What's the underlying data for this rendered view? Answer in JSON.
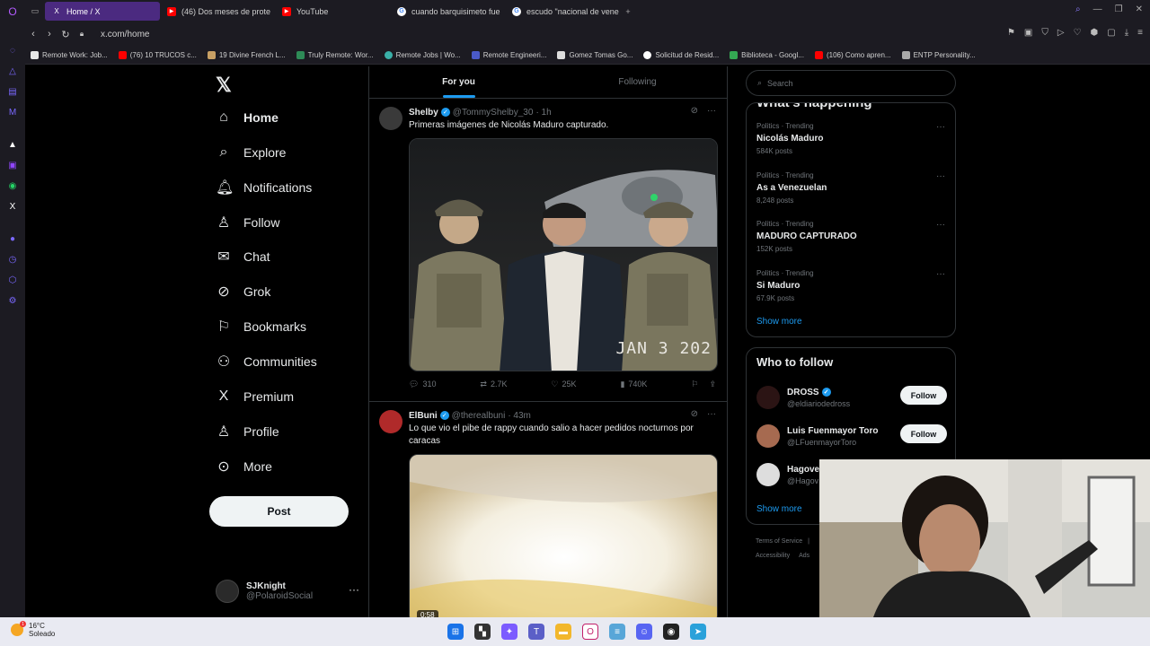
{
  "browser": {
    "tabs": [
      {
        "title": "Home / X",
        "icon": "x-logo-icon",
        "active": true
      },
      {
        "title": "(46) Dos meses de prote",
        "icon": "youtube-icon"
      },
      {
        "title": "YouTube",
        "icon": "youtube-icon"
      },
      {
        "title": "cuando barquisimeto fue",
        "icon": "google-icon"
      },
      {
        "title": "escudo \"nacional de vene",
        "icon": "google-icon"
      }
    ],
    "url": "x.com/home",
    "bookmarks": [
      {
        "label": "Remote Work: Job...",
        "color": "#e7e7e7"
      },
      {
        "label": "(76) 10 TRUCOS c...",
        "color": "#ff0000"
      },
      {
        "label": "19 Divine French L...",
        "color": "#c8a064"
      },
      {
        "label": "Truly Remote: Wor...",
        "color": "#2e8b57"
      },
      {
        "label": "Remote Jobs | Wo...",
        "color": "#3ab0a8"
      },
      {
        "label": "Remote Engineeri...",
        "color": "#4a5ac8"
      },
      {
        "label": "Gomez Tomas Go...",
        "color": "#dddddd"
      },
      {
        "label": "Solicitud de Resid...",
        "color": "#ffffff"
      },
      {
        "label": "Biblioteca - Googl...",
        "color": "#34a853"
      },
      {
        "label": "(106) Como apren...",
        "color": "#ff0000"
      },
      {
        "label": "ENTP Personality...",
        "color": "#aaaaaa"
      }
    ]
  },
  "nav": {
    "items": [
      {
        "label": "Home",
        "icon": "home-icon",
        "glyph": "⌂",
        "active": true
      },
      {
        "label": "Explore",
        "icon": "search-icon",
        "glyph": "⌕"
      },
      {
        "label": "Notifications",
        "icon": "bell-icon",
        "glyph": "♫"
      },
      {
        "label": "Follow",
        "icon": "person-plus-icon",
        "glyph": "⚇"
      },
      {
        "label": "Chat",
        "icon": "mail-icon",
        "glyph": "✉"
      },
      {
        "label": "Grok",
        "icon": "grok-icon",
        "glyph": "⊘"
      },
      {
        "label": "Bookmarks",
        "icon": "bookmark-icon",
        "glyph": "⚐"
      },
      {
        "label": "Communities",
        "icon": "people-icon",
        "glyph": "⚉"
      },
      {
        "label": "Premium",
        "icon": "x-logo-icon",
        "glyph": "X"
      },
      {
        "label": "Profile",
        "icon": "person-icon",
        "glyph": "♙"
      },
      {
        "label": "More",
        "icon": "more-circle-icon",
        "glyph": "⊙"
      }
    ],
    "post_label": "Post",
    "account": {
      "name": "SJKnight",
      "handle": "@PolaroidSocial"
    }
  },
  "feed": {
    "tabs": [
      "For you",
      "Following"
    ],
    "tweets": [
      {
        "name": "Shelby",
        "handle": "@TommyShelby_30",
        "time": "· 1h",
        "text": "Primeras imágenes de Nicolás Maduro capturado.",
        "media_caption": "JAN 3 202",
        "replies": "310",
        "retweets": "2.7K",
        "likes": "25K",
        "views": "740K"
      },
      {
        "name": "ElBuni",
        "handle": "@therealbuni",
        "time": "· 43m",
        "text": "Lo que vio el pibe de rappy cuando salio a hacer pedidos nocturnos por caracas",
        "video_duration": "0:58"
      }
    ]
  },
  "right": {
    "search_placeholder": "Search",
    "happening_title": "What's happening",
    "trends": [
      {
        "category": "Politics · Trending",
        "name": "Nicolás Maduro",
        "count": "584K posts"
      },
      {
        "category": "Politics · Trending",
        "name": "As a Venezuelan",
        "count": "8,248 posts"
      },
      {
        "category": "Politics · Trending",
        "name": "MADURO CAPTURADO",
        "count": "152K posts"
      },
      {
        "category": "Politics · Trending",
        "name": "Si Maduro",
        "count": "67.9K posts"
      }
    ],
    "show_more": "Show more",
    "who_to_follow_title": "Who to follow",
    "suggestions": [
      {
        "name": "DROSS",
        "handle": "@eldiariodedross",
        "verified": true,
        "follow": "Follow"
      },
      {
        "name": "Luis Fuenmayor Toro",
        "handle": "@LFuenmayorToro",
        "verified": false,
        "follow": "Follow"
      },
      {
        "name": "Hagover",
        "handle": "@Hagov",
        "verified": false
      }
    ],
    "show_more_2": "Show more",
    "footer_1": "Terms of Service",
    "footer_2": "Accessibility",
    "footer_3": "Ads"
  },
  "taskbar": {
    "temp": "16°C",
    "condition": "Soleado",
    "badge": "1"
  }
}
